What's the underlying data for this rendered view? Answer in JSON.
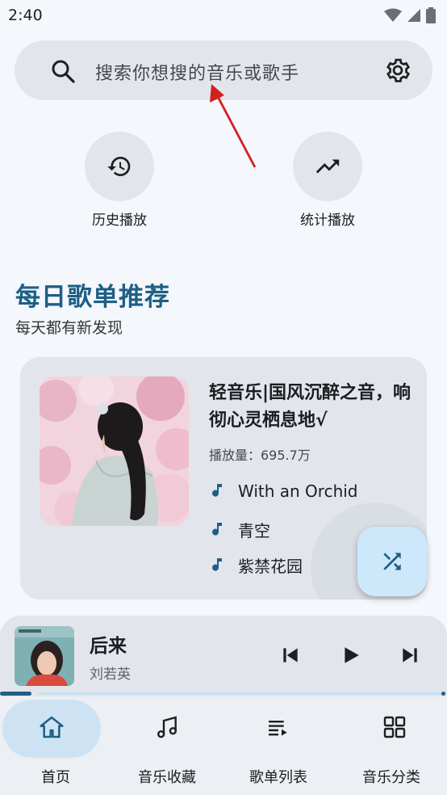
{
  "status": {
    "time": "2:40"
  },
  "search": {
    "placeholder": "搜索你想搜的音乐或歌手"
  },
  "quick_actions": [
    {
      "label": "历史播放",
      "icon": "history-icon"
    },
    {
      "label": "统计播放",
      "icon": "trending-up-icon"
    }
  ],
  "section": {
    "title": "每日歌单推荐",
    "subtitle": "每天都有新发现"
  },
  "playlist": {
    "title": "轻音乐|国风沉醉之音，响彻心灵栖息地√",
    "plays": "播放量：695.7万",
    "songs": [
      "With an Orchid",
      "青空",
      "紫禁花园"
    ]
  },
  "player": {
    "title": "后来",
    "artist": "刘若英",
    "progress": 0.07
  },
  "nav": {
    "items": [
      {
        "label": "首页",
        "icon": "home-icon"
      },
      {
        "label": "音乐收藏",
        "icon": "music-collection-icon"
      },
      {
        "label": "歌单列表",
        "icon": "playlist-icon"
      },
      {
        "label": "音乐分类",
        "icon": "grid-category-icon"
      }
    ]
  },
  "colors": {
    "accent": "#1e5f86",
    "fab": "#cde8fb",
    "surface": "#e2e6ec",
    "background": "#f4f7fb"
  }
}
